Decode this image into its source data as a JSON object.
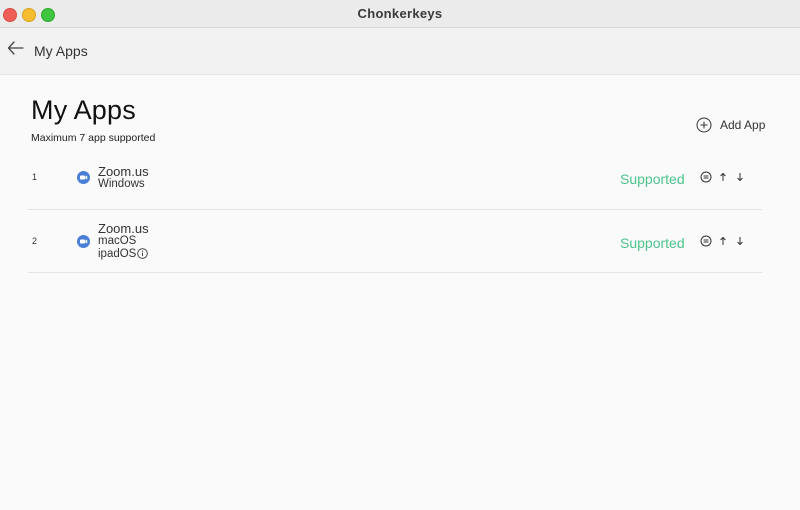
{
  "window": {
    "title": "Chonkerkeys"
  },
  "toolbar": {
    "back_icon": "arrow-left-icon",
    "title": "My Apps"
  },
  "header": {
    "title": "My Apps",
    "subtitle": "Maximum 7 app supported",
    "add_label": "Add App",
    "add_icon": "plus-circle-icon"
  },
  "colors": {
    "status": "#4cc38a",
    "app_icon": "#4a7fd6"
  },
  "apps": [
    {
      "index": "1",
      "name": "Zoom.us",
      "platforms": [
        "Windows"
      ],
      "status": "Supported",
      "icon": "zoom-icon"
    },
    {
      "index": "2",
      "name": "Zoom.us",
      "platforms": [
        "macOS",
        "ipadOS"
      ],
      "status": "Supported",
      "icon": "zoom-icon"
    }
  ]
}
